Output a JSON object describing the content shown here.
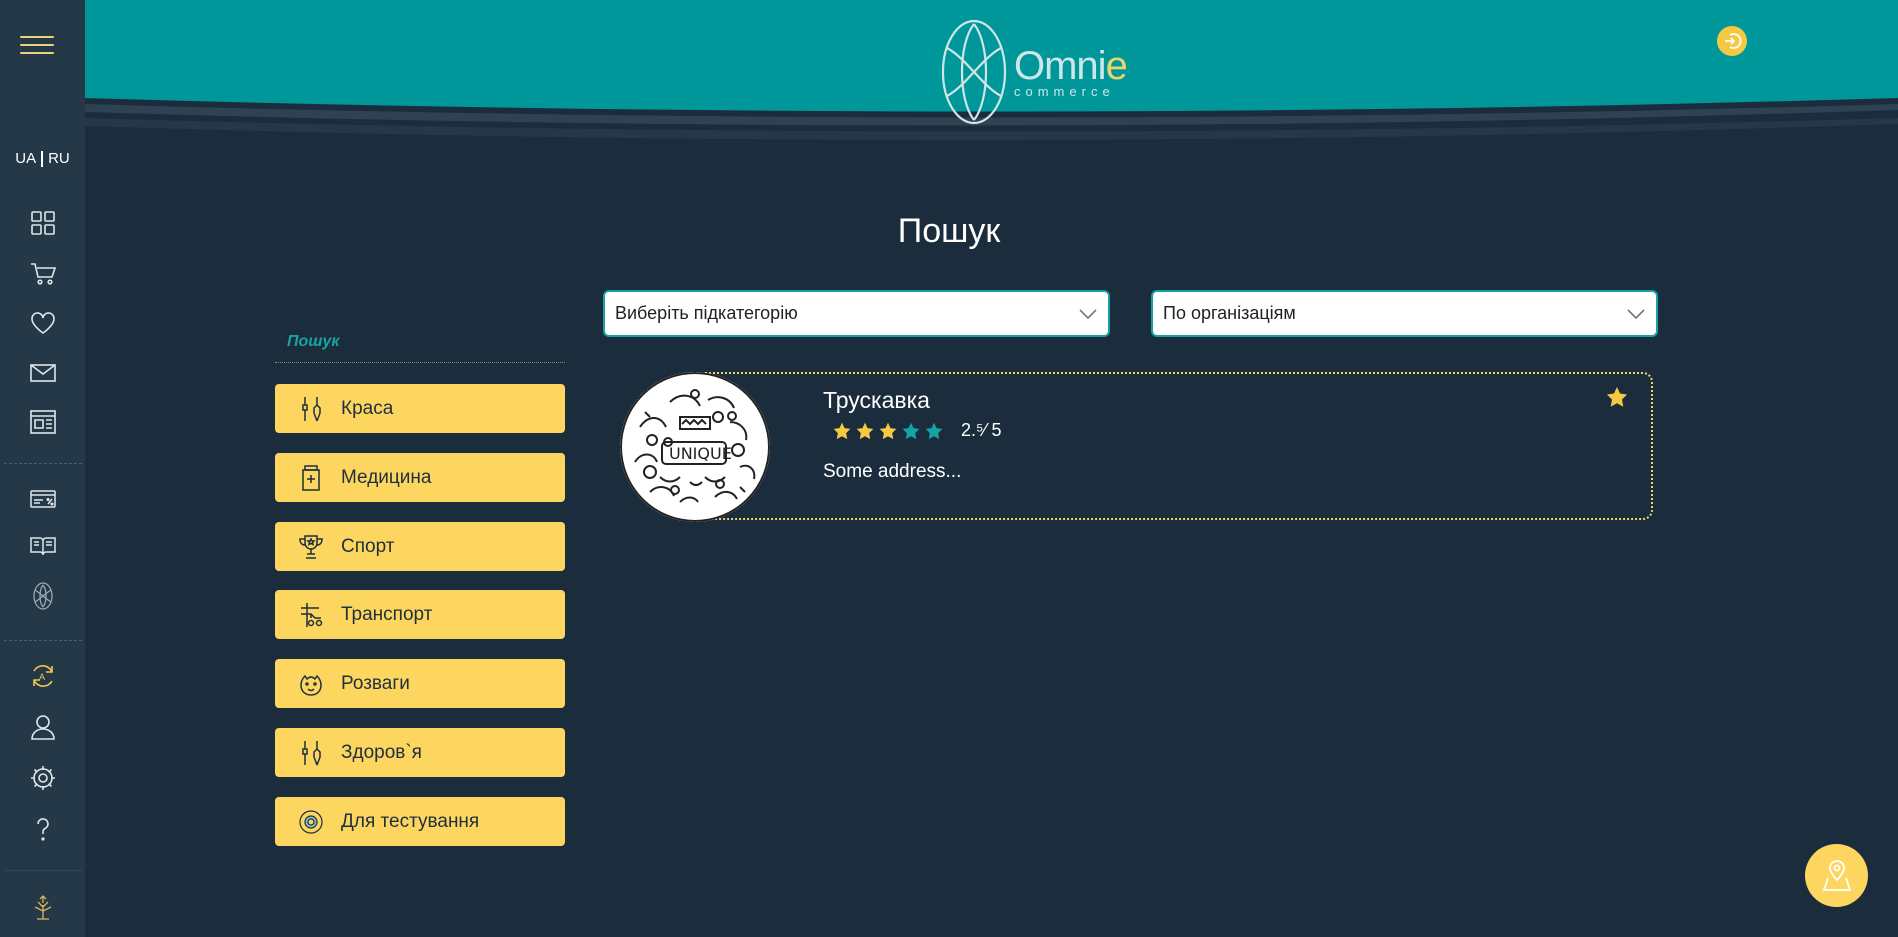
{
  "lang": {
    "ua": "UA",
    "ru": "RU"
  },
  "logo": {
    "name_main": "Omni",
    "name_accent": "e",
    "sub": "commerce"
  },
  "page": {
    "title": "Пошук"
  },
  "filters": {
    "subtitle": "Пошук"
  },
  "categories": [
    {
      "label": "Краса",
      "icon": "beauty-tools-icon"
    },
    {
      "label": "Медицина",
      "icon": "medicine-bottle-icon"
    },
    {
      "label": "Спорт",
      "icon": "trophy-icon"
    },
    {
      "label": "Транспорт",
      "icon": "transport-icon"
    },
    {
      "label": "Розваги",
      "icon": "entertainment-icon"
    },
    {
      "label": "Здоров`я",
      "icon": "health-tools-icon"
    },
    {
      "label": "Для тестування",
      "icon": "test-icon"
    }
  ],
  "selects": {
    "subcategory": "Виберіть підкатегорію",
    "sort": "По організаціям"
  },
  "result": {
    "name": "Трускавка",
    "rating_text": "2.⁵⁄ 5",
    "rating_value": 2.5,
    "rating_max": 5,
    "address": "Some address..."
  },
  "colors": {
    "accent": "#16a3a3",
    "yellow": "#fdd660",
    "bg": "#1b2d3c",
    "header": "#00979a"
  }
}
